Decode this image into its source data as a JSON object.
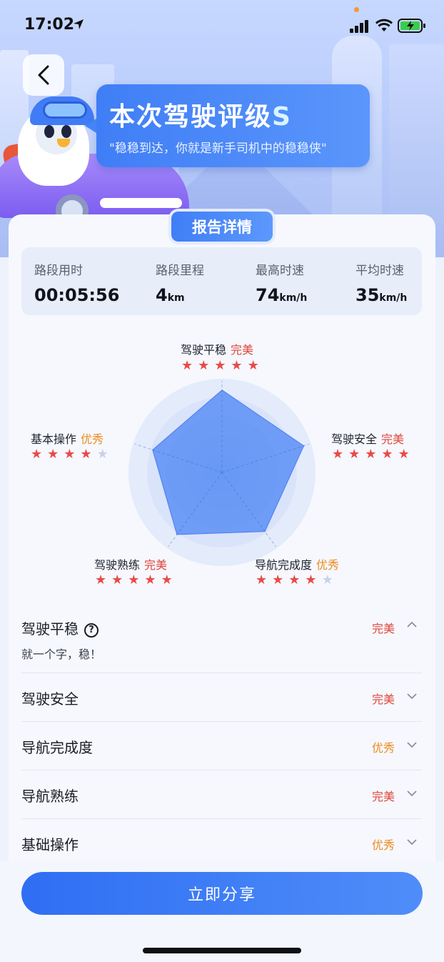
{
  "status_bar": {
    "time": "17:02"
  },
  "header": {
    "grade_title_prefix": "本次驾驶评级",
    "grade_letter": "S",
    "grade_quote": "\"稳稳到达，你就是新手司机中的稳稳侠\""
  },
  "report": {
    "tab_label": "报告详情",
    "stats": [
      {
        "label": "路段用时",
        "value": "00:05:56",
        "unit": ""
      },
      {
        "label": "路段里程",
        "value": "4",
        "unit": "km"
      },
      {
        "label": "最高时速",
        "value": "74",
        "unit": "km/h"
      },
      {
        "label": "平均时速",
        "value": "35",
        "unit": "km/h"
      }
    ]
  },
  "radar": {
    "dimensions": [
      {
        "name": "驾驶平稳",
        "grade": "完美",
        "stars": 5,
        "score": 0.88
      },
      {
        "name": "驾驶安全",
        "grade": "完美",
        "stars": 5,
        "score": 0.92
      },
      {
        "name": "导航完成度",
        "grade": "优秀",
        "stars": 4,
        "score": 0.78
      },
      {
        "name": "驾驶熟练",
        "grade": "完美",
        "stars": 5,
        "score": 0.82
      },
      {
        "name": "基本操作",
        "grade": "优秀",
        "stars": 4,
        "score": 0.78
      }
    ],
    "max_stars": 5
  },
  "details": {
    "rows": [
      {
        "name": "驾驶平稳",
        "grade": "完美",
        "expanded": true,
        "desc": "就一个字，稳！"
      },
      {
        "name": "驾驶安全",
        "grade": "完美",
        "expanded": false
      },
      {
        "name": "导航完成度",
        "grade": "优秀",
        "expanded": false
      },
      {
        "name": "导航熟练",
        "grade": "完美",
        "expanded": false
      },
      {
        "name": "基础操作",
        "grade": "优秀",
        "expanded": false
      }
    ]
  },
  "footer": {
    "share_label": "立即分享"
  },
  "colors": {
    "accent": "#3f7ef6",
    "perfect": "#e0453b",
    "good": "#ee8a1f",
    "star_on": "#e84a4a",
    "star_off": "#c9d2e6"
  }
}
